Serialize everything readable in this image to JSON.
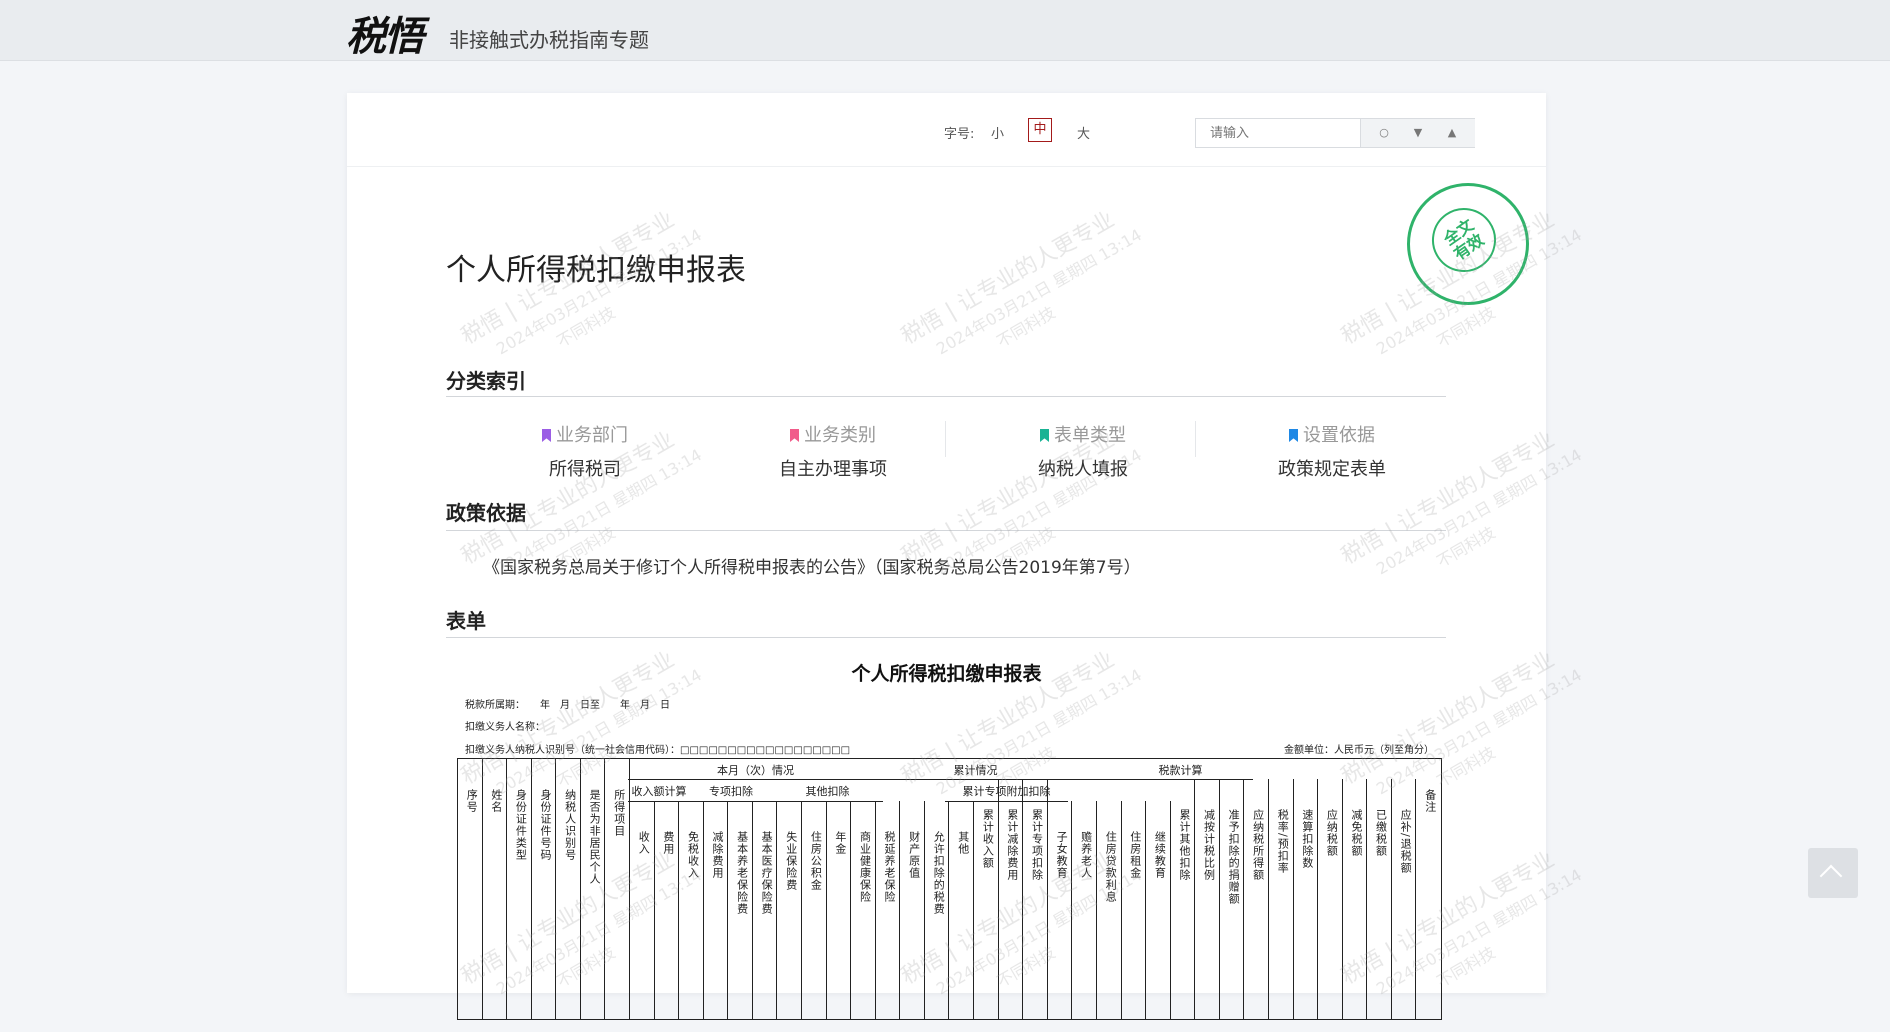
{
  "header": {
    "logo_text": "税悟",
    "subtitle": "非接触式办税指南专题"
  },
  "toolbar": {
    "font_size_label": "字号:",
    "font_small": "小",
    "font_medium": "中",
    "font_large": "大",
    "search_placeholder": "请输入",
    "active_font_size": "中"
  },
  "stamp": {
    "line1": "全文",
    "line2": "有效",
    "color": "#2fb36a"
  },
  "doc": {
    "title": "个人所得税扣缴申报表",
    "sections": {
      "index": "分类索引",
      "policy": "政策依据",
      "form": "表单"
    },
    "categories": [
      {
        "key": "业务部门",
        "value": "所得税司",
        "color": "#9b5de5"
      },
      {
        "key": "业务类别",
        "value": "自主办理事项",
        "color": "#f15b8a"
      },
      {
        "key": "表单类型",
        "value": "纳税人填报",
        "color": "#19b394"
      },
      {
        "key": "设置依据",
        "value": "政策规定表单",
        "color": "#1e88e5"
      }
    ],
    "policy_text": "《国家税务总局关于修订个人所得税申报表的公告》（国家税务总局公告2019年第7号）"
  },
  "form": {
    "title": "个人所得税扣缴申报表",
    "period": "税款所属期：　　年　月　日至　　年　月　日",
    "agent_name": "扣缴义务人名称：",
    "agent_id": "扣缴义务人纳税人识别号（统一社会信用代码）：□□□□□□□□□□□□□□□□□□",
    "unit": "金额单位：人民币元（列至角分）",
    "group_headers": {
      "current": "本月（次）情况",
      "cumulative": "累计情况",
      "tax_calc": "税款计算",
      "income_calc": "收入额计算",
      "special_deduction": "专项扣除",
      "other_deduction": "其他扣除",
      "cum_special_add": "累计专项附加扣除"
    },
    "columns": [
      "序号",
      "姓名",
      "身份证件类型",
      "身份证件号码",
      "纳税人识别号",
      "是否为非居民个人",
      "所得项目",
      "收入",
      "费用",
      "免税收入",
      "减除费用",
      "基本养老保险费",
      "基本医疗保险费",
      "失业保险费",
      "住房公积金",
      "年金",
      "商业健康保险",
      "税延养老保险",
      "财产原值",
      "允许扣除的税费",
      "其他",
      "累计收入额",
      "累计减除费用",
      "累计专项扣除",
      "子女教育",
      "赡养老人",
      "住房贷款利息",
      "住房租金",
      "继续教育",
      "累计其他扣除",
      "减按计税比例",
      "准予扣除的捐赠额",
      "应纳税所得额",
      "税率/预扣率",
      "速算扣除数",
      "应纳税额",
      "减免税额",
      "已缴税额",
      "应补/退税额",
      "备注"
    ]
  },
  "watermark": {
    "line1": "税悟 | 让专业的人更专业",
    "line2": "2024年03月21日 星期四 13:14",
    "line3": "不同科技"
  }
}
